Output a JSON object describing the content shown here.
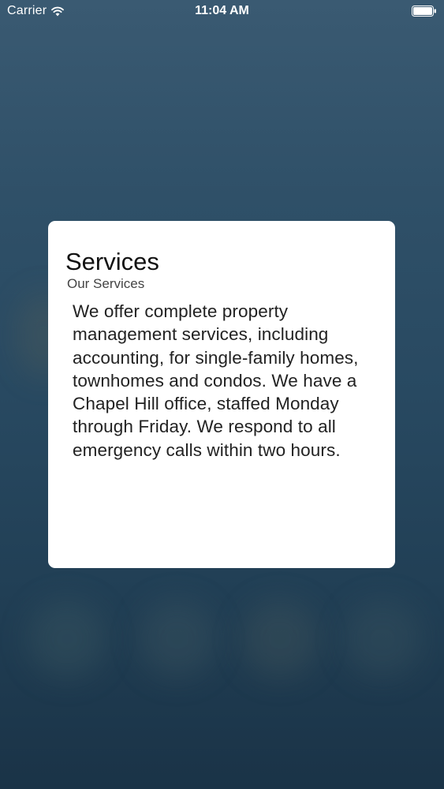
{
  "status_bar": {
    "carrier": "Carrier",
    "time": "11:04 AM",
    "wifi_icon": "wifi-icon",
    "battery_icon": "battery-icon"
  },
  "dialog": {
    "title": "Services",
    "subtitle": "Our Services",
    "body": "We offer complete property management services, including accounting, for single-family homes, townhomes and condos. We have a Chapel Hill office, staffed Monday through Friday. We respond to all emergency calls within two hours."
  },
  "colors": {
    "background": "#284961",
    "card": "#ffffff",
    "status_text": "#ffffff"
  }
}
